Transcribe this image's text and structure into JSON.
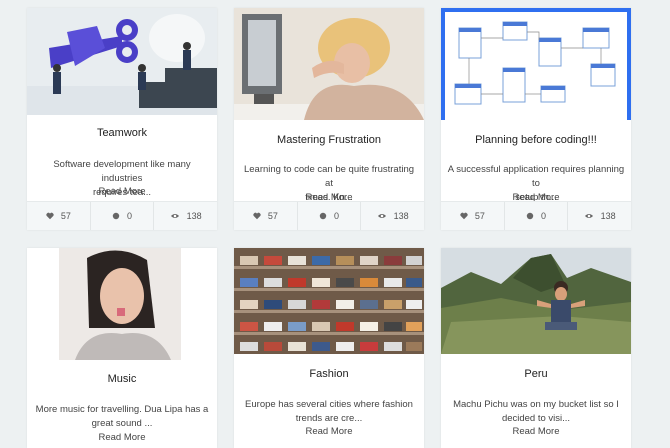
{
  "cards": [
    {
      "title": "Teamwork",
      "excerpt_line1": "Software development like many industries",
      "excerpt_line2": "requires tea...",
      "read_more": "Read More",
      "likes": "57",
      "comments": "0",
      "views": "138"
    },
    {
      "title": "Mastering Frustration",
      "excerpt_line1": "Learning to code can be quite frustrating at",
      "excerpt_line2": "times. Kn...",
      "read_more": "Read More",
      "likes": "57",
      "comments": "0",
      "views": "138"
    },
    {
      "title": "Planning before coding!!!",
      "excerpt_line1": "A successful application requires planning to",
      "excerpt_line2": "setup th...",
      "read_more": "Read More",
      "likes": "57",
      "comments": "0",
      "views": "138"
    },
    {
      "title": "Music",
      "excerpt_line1": "More music for travelling. Dua Lipa has a",
      "excerpt_line2": "great sound ...",
      "read_more": "Read More"
    },
    {
      "title": "Fashion",
      "excerpt_line1": "Europe has several cities where fashion",
      "excerpt_line2": "trends are cre...",
      "read_more": "Read More"
    },
    {
      "title": "Peru",
      "excerpt_line1": "Machu Pichu was on my bucket list so I",
      "excerpt_line2": "decided to visi...",
      "read_more": "Read More"
    }
  ],
  "icons": {
    "like": "heart-icon",
    "comment": "comment-icon",
    "view": "eye-icon"
  },
  "colors": {
    "background": "#edf1f2",
    "planning_border": "#2f6ff0"
  }
}
